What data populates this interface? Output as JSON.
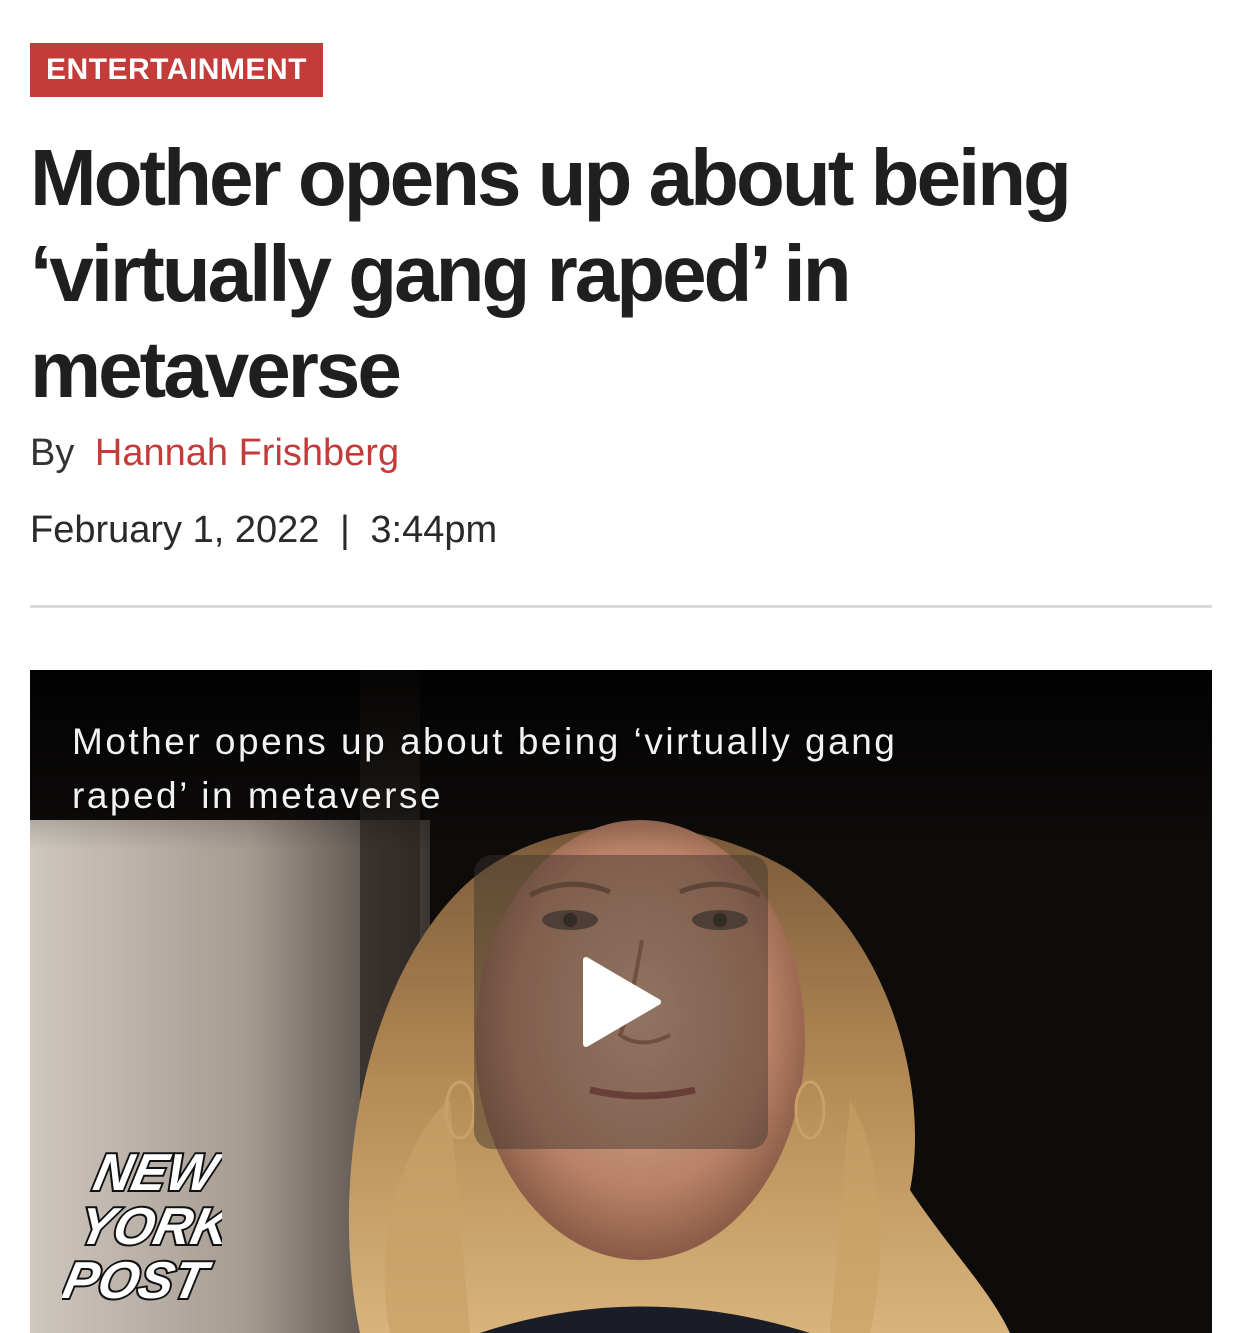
{
  "article": {
    "category": "ENTERTAINMENT",
    "headline": "Mother opens up about being ‘virtually gang raped’ in metaverse",
    "byline_prefix": "By",
    "author": "Hannah Frishberg",
    "date": "February 1, 2022",
    "time_separator": "|",
    "time": "3:44pm"
  },
  "video": {
    "title": "Mother opens up about being ‘virtually gang raped’ in metaverse",
    "play_icon": "play-icon",
    "logo_lines": [
      "NEW",
      "YORK",
      "POST"
    ]
  },
  "colors": {
    "accent": "#c33c39",
    "headline": "#1f1f1f",
    "divider": "#d9d9d9"
  }
}
